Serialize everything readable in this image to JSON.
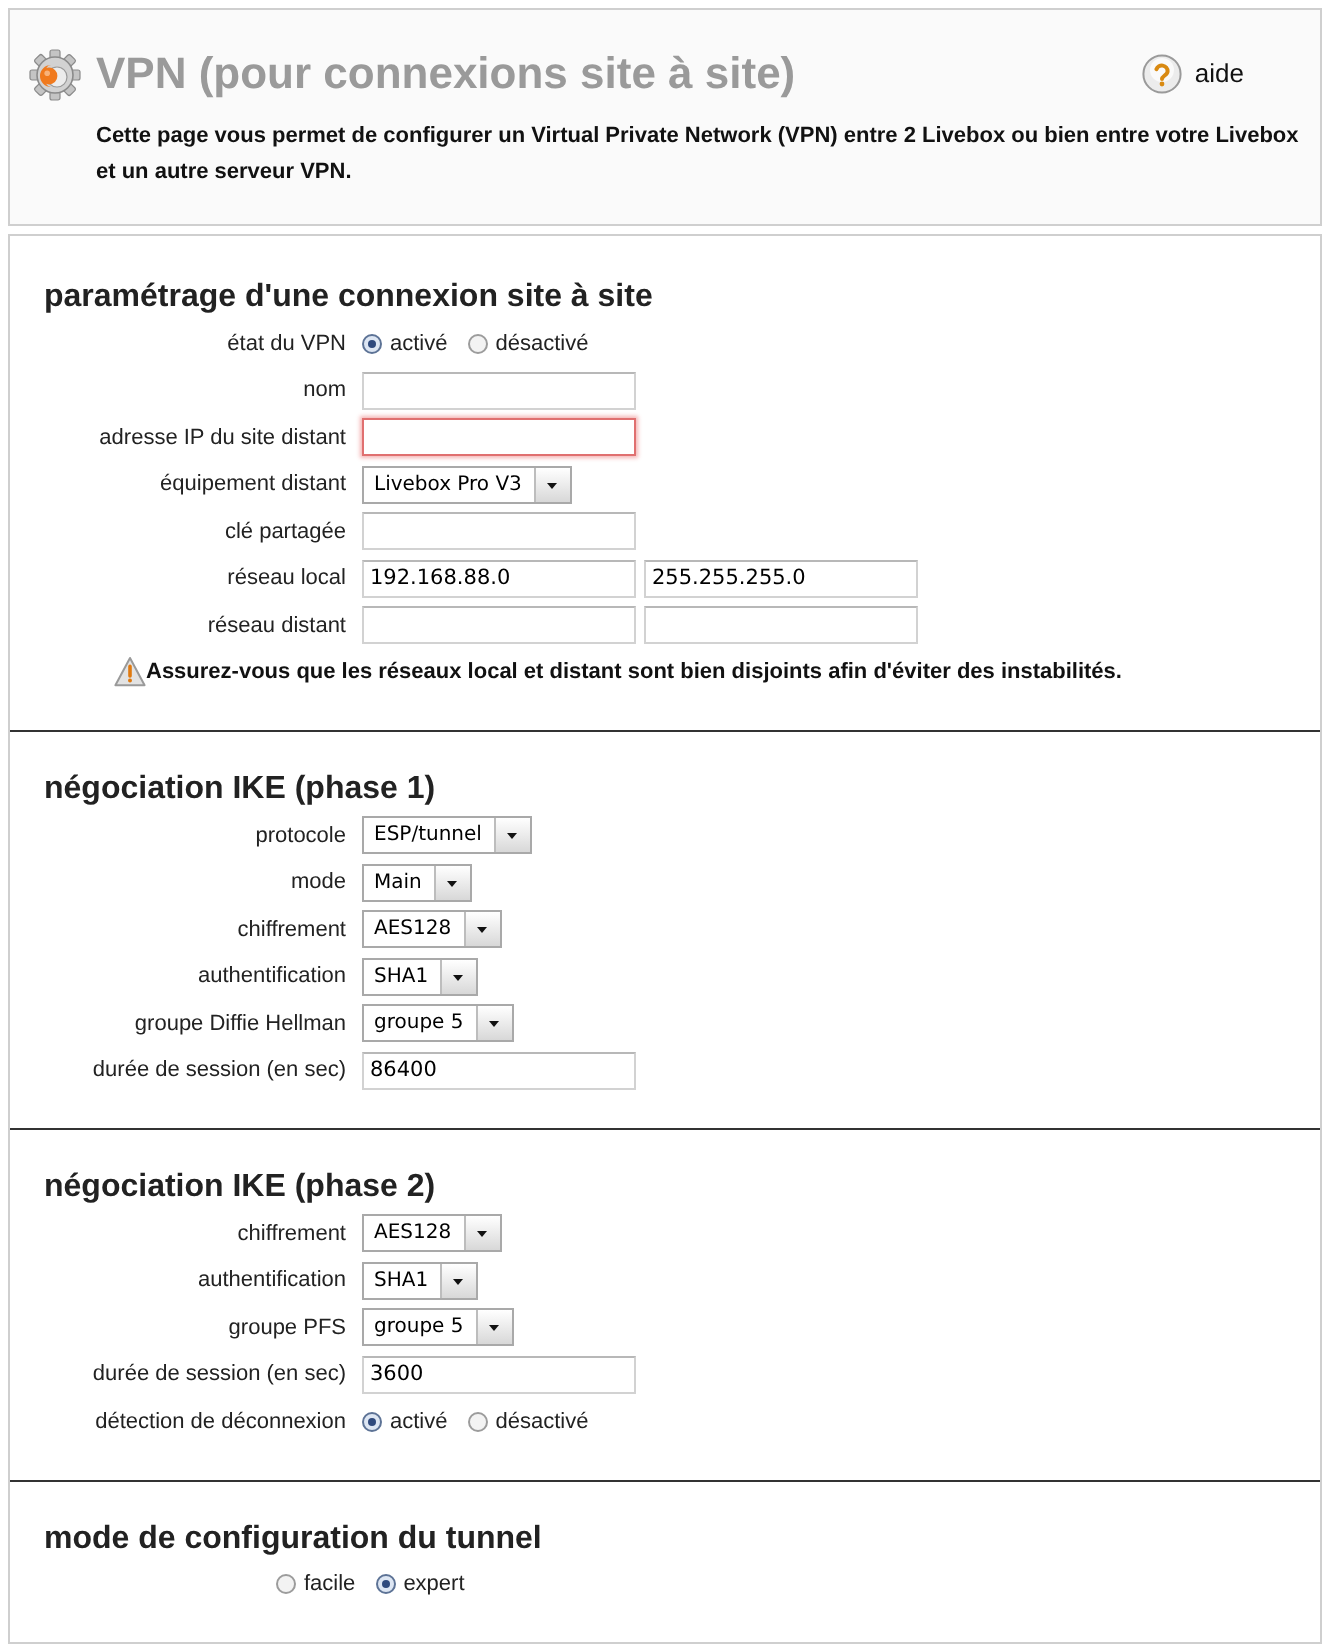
{
  "header": {
    "title": "VPN (pour connexions site à site)",
    "help_link": "aide",
    "description": "Cette page vous permet de configurer un Virtual Private Network (VPN) entre 2 Livebox ou bien entre votre Livebox et un autre serveur VPN."
  },
  "sections": [
    {
      "title": "paramétrage d'une connexion site à site",
      "fields": [
        {
          "kind": "radio",
          "label": "état du VPN",
          "options": [
            {
              "label": "activé",
              "selected": true
            },
            {
              "label": "désactivé",
              "selected": false
            }
          ]
        },
        {
          "kind": "text",
          "label": "nom",
          "inputs": [
            {
              "error": false
            }
          ]
        },
        {
          "kind": "text",
          "label": "adresse IP du site distant",
          "inputs": [
            {
              "error": true
            }
          ]
        },
        {
          "kind": "select",
          "label": "équipement distant",
          "value": "Livebox Pro V3"
        },
        {
          "kind": "text",
          "label": "clé partagée",
          "inputs": [
            {
              "error": false
            }
          ]
        },
        {
          "kind": "text",
          "label": "réseau local",
          "inputs": [
            {
              "value": "192.168.88.0",
              "error": false
            },
            {
              "value": "255.255.255.0",
              "error": false
            }
          ]
        },
        {
          "kind": "text",
          "label": "réseau distant",
          "inputs": [
            {
              "error": false
            },
            {
              "error": false
            }
          ]
        }
      ],
      "warning": "Assurez-vous que les réseaux local et distant sont bien disjoints afin d'éviter des instabilités."
    },
    {
      "title": "négociation IKE (phase 1)",
      "fields": [
        {
          "kind": "select",
          "label": "protocole",
          "value": "ESP/tunnel"
        },
        {
          "kind": "select",
          "label": "mode",
          "value": "Main"
        },
        {
          "kind": "select",
          "label": "chiffrement",
          "value": "AES128"
        },
        {
          "kind": "select",
          "label": "authentification",
          "value": "SHA1"
        },
        {
          "kind": "select",
          "label": "groupe Diffie Hellman",
          "value": "groupe 5"
        },
        {
          "kind": "text",
          "label": "durée de session (en sec)",
          "inputs": [
            {
              "value": "86400",
              "error": false
            }
          ]
        }
      ]
    },
    {
      "title": "négociation IKE (phase 2)",
      "fields": [
        {
          "kind": "select",
          "label": "chiffrement",
          "value": "AES128"
        },
        {
          "kind": "select",
          "label": "authentification",
          "value": "SHA1"
        },
        {
          "kind": "select",
          "label": "groupe PFS",
          "value": "groupe 5"
        },
        {
          "kind": "text",
          "label": "durée de session (en sec)",
          "inputs": [
            {
              "value": "3600",
              "error": false
            }
          ]
        },
        {
          "kind": "radio",
          "label": "détection de déconnexion",
          "options": [
            {
              "label": "activé",
              "selected": true
            },
            {
              "label": "désactivé",
              "selected": false
            }
          ]
        }
      ]
    },
    {
      "title": "mode de configuration du tunnel",
      "fields": [
        {
          "kind": "radio",
          "options": [
            {
              "label": "facile",
              "selected": false
            },
            {
              "label": "expert",
              "selected": true
            }
          ]
        }
      ]
    }
  ]
}
